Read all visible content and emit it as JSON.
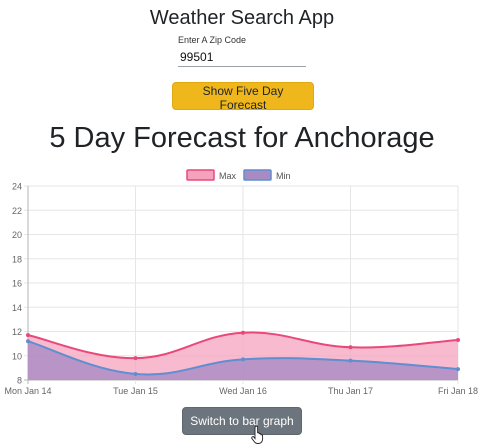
{
  "app": {
    "title": "Weather Search App"
  },
  "search": {
    "label": "Enter A Zip Code",
    "value": "99501"
  },
  "buttons": {
    "forecast": "Show Five Day Forecast",
    "toggle": "Switch to bar graph"
  },
  "colors": {
    "primary": "#f0b71c",
    "secondary": "#6c757d",
    "max_line": "#e8497a",
    "max_fill": "#f5a3bd",
    "min_line": "#5f8ed1",
    "min_fill": "#a98bc4"
  },
  "chart_data": {
    "type": "area",
    "title": "5 Day Forecast for Anchorage",
    "categories": [
      "Mon Jan 14",
      "Tue Jan 15",
      "Wed Jan 16",
      "Thu Jan 17",
      "Fri Jan 18"
    ],
    "series": [
      {
        "name": "Max",
        "values": [
          11.7,
          9.8,
          11.9,
          10.7,
          11.3
        ]
      },
      {
        "name": "Min",
        "values": [
          11.2,
          8.5,
          9.7,
          9.6,
          8.9
        ]
      }
    ],
    "ylim": [
      8,
      24
    ],
    "yticks": [
      8,
      10,
      12,
      14,
      16,
      18,
      20,
      22,
      24
    ],
    "grid": true,
    "legend": "top"
  }
}
